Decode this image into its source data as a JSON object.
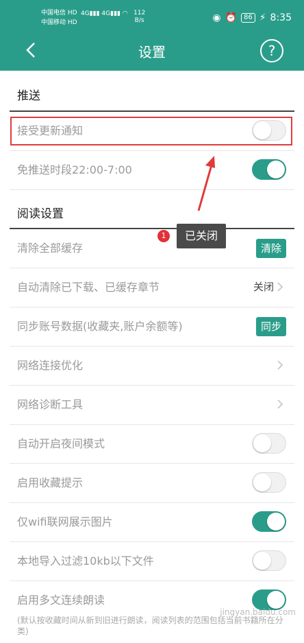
{
  "status_bar": {
    "carrier1": "中国电信",
    "carrier2": "中国移动",
    "hd": "HD",
    "network": "4G",
    "speed_value": "112",
    "speed_unit": "B/s",
    "battery": "86",
    "time": "8:35"
  },
  "header": {
    "title": "设置",
    "help_glyph": "?"
  },
  "sections": {
    "push_title": "推送",
    "reading_title": "阅读设置"
  },
  "rows": {
    "accept_update": {
      "label": "接受更新通知",
      "toggle": "off"
    },
    "no_push_period": {
      "label": "免推送时段22:00-7:00",
      "toggle": "on"
    },
    "clear_cache": {
      "label": "清除全部缓存",
      "button": "清除"
    },
    "auto_clear": {
      "label": "自动清除已下载、已缓存章节",
      "value": "关闭"
    },
    "sync_account": {
      "label": "同步账号数据(收藏夹,账户余额等)",
      "button": "同步"
    },
    "network_opt": {
      "label": "网络连接优化"
    },
    "network_diag": {
      "label": "网络诊断工具"
    },
    "auto_night": {
      "label": "自动开启夜间模式",
      "toggle": "off"
    },
    "fav_tip": {
      "label": "启用收藏提示",
      "toggle": "off"
    },
    "wifi_images": {
      "label": "仅wifi联网展示图片",
      "toggle": "on"
    },
    "import_filter": {
      "label": "本地导入过滤10kb以下文件",
      "toggle": "off"
    },
    "multi_read": {
      "label": "启用多文连续朗读",
      "toggle": "on"
    }
  },
  "footnote": "(默认按收藏时间从新到旧进行朗读，阅读列表的范围包括当前书籍所在分类)",
  "annotation": {
    "badge": "1",
    "tooltip": "已关闭"
  },
  "watermark": "jingyan.baidu.com",
  "colors": {
    "accent": "#2a9d8a",
    "highlight": "#e03b3b"
  }
}
